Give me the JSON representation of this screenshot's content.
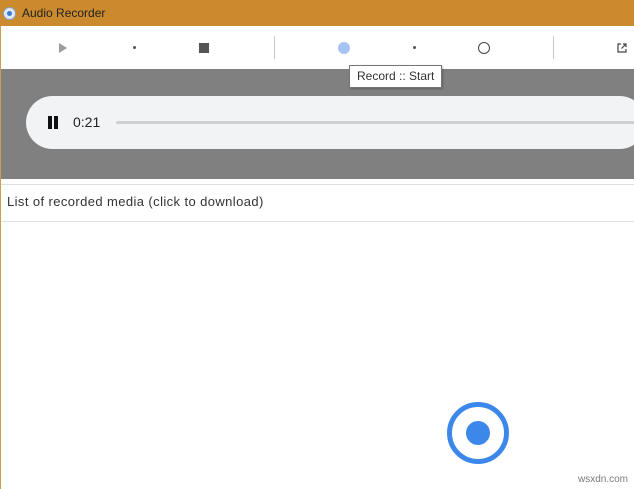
{
  "window": {
    "title": "Audio Recorder"
  },
  "toolbar": {
    "buttons": [
      {
        "name": "play",
        "icon": "play-icon"
      },
      {
        "name": "dot",
        "icon": "dot-icon"
      },
      {
        "name": "stop",
        "icon": "stop-icon"
      },
      {
        "name": "record",
        "icon": "record-icon"
      },
      {
        "name": "dot",
        "icon": "dot-icon"
      },
      {
        "name": "record-options",
        "icon": "ring-icon"
      },
      {
        "name": "open-external",
        "icon": "external-link-icon"
      }
    ],
    "tooltip": "Record :: Start"
  },
  "player": {
    "time": "0:21",
    "state": "playing"
  },
  "recorded_list": {
    "label": "List of recorded media (click to download)",
    "items": []
  },
  "record_button": {
    "icon": "record-icon",
    "color": "#3c88ea"
  },
  "watermark": "wsxdn.com",
  "colors": {
    "titlebar": "#cc8a2e",
    "player_area": "#808080",
    "accent": "#3c88ea"
  }
}
